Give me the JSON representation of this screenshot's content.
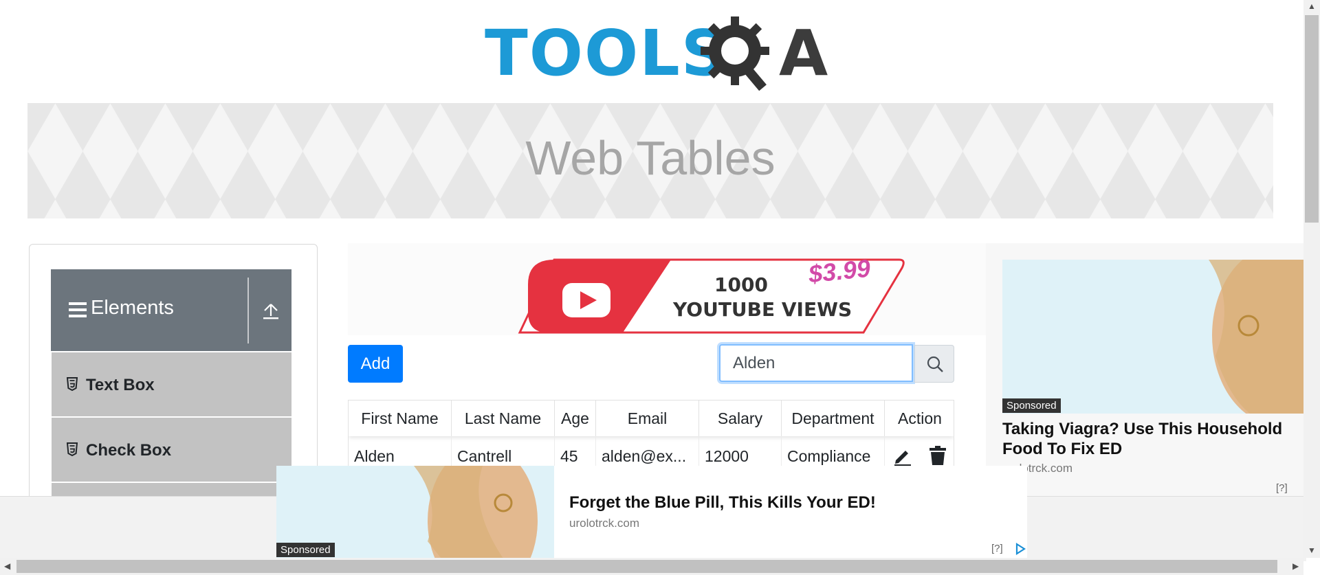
{
  "logo": {
    "text_left": "TOOLS",
    "text_right": "A"
  },
  "page": {
    "title": "Web Tables"
  },
  "sidebar": {
    "group": {
      "label": "Elements"
    },
    "items": [
      {
        "label": "Text Box"
      },
      {
        "label": "Check Box"
      }
    ]
  },
  "promo_ad": {
    "line1": "1000",
    "line2": "YOUTUBE VIEWS",
    "price": "$3.99"
  },
  "toolbar": {
    "add_label": "Add",
    "search_value": "Alden"
  },
  "table": {
    "headers": [
      "First Name",
      "Last Name",
      "Age",
      "Email",
      "Salary",
      "Department",
      "Action"
    ],
    "rows": [
      {
        "first_name": "Alden",
        "last_name": "Cantrell",
        "age": "45",
        "email": "alden@ex...",
        "salary": "12000",
        "department": "Compliance"
      }
    ]
  },
  "right_ad": {
    "sponsored": "Sponsored",
    "title": "Taking Viagra? Use This Household Food To Fix ED",
    "domain": "urolotrck.com",
    "help": "[?]"
  },
  "bottom_ad": {
    "sponsored": "Sponsored",
    "title": "Forget the Blue Pill, This Kills Your ED!",
    "domain": "urolotrck.com",
    "help": "[?]"
  },
  "colors": {
    "accent": "#007bff",
    "sidebar_header": "#6c757d",
    "sidebar_item": "#c2c2c2",
    "logo_blue": "#1d9ad6"
  }
}
